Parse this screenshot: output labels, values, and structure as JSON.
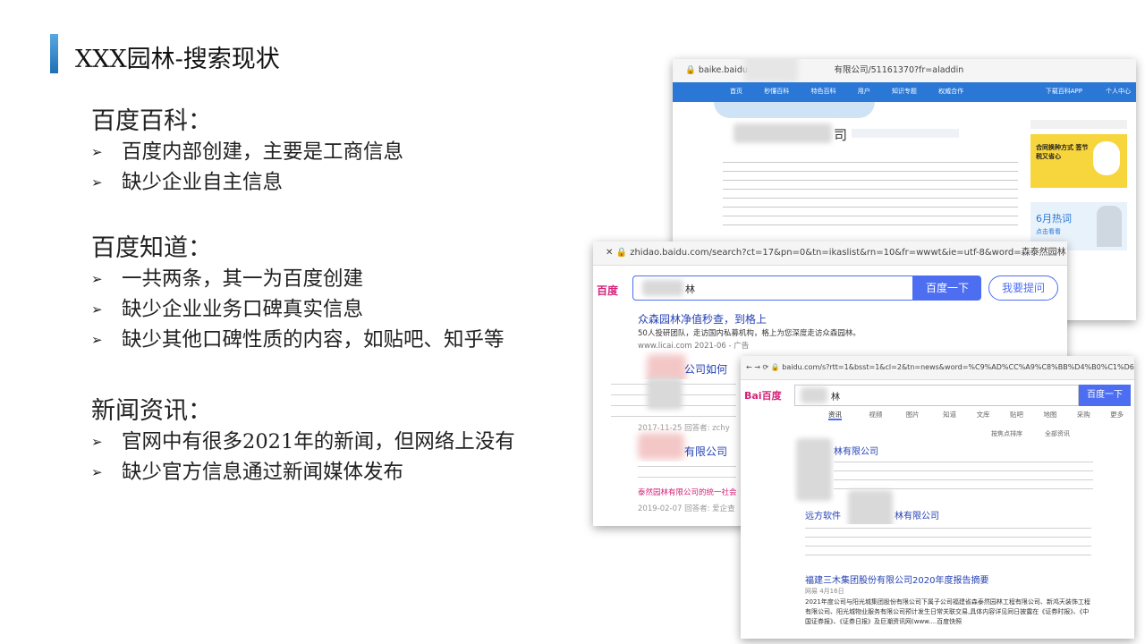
{
  "slide": {
    "title": "XXX园林-搜索现状",
    "accent": "#1f6fb5"
  },
  "sections": [
    {
      "heading": "百度百科：",
      "bullets": [
        "百度内部创建，主要是工商信息",
        "缺少企业自主信息"
      ]
    },
    {
      "heading": "百度知道：",
      "bullets": [
        "一共两条，其一为百度创建",
        "缺少企业业务口碑真实信息",
        "缺少其他口碑性质的内容，如贴吧、知乎等"
      ]
    },
    {
      "heading": "新闻资讯：",
      "bullets": [
        "官网中有很多2021年的新闻，但网络上没有",
        "缺少官方信息通过新闻媒体发布"
      ]
    }
  ],
  "baike": {
    "url_prefix": "baike.baidu.com/",
    "url_suffix": "有限公司/51161370?fr=aladdin",
    "nav": [
      "首页",
      "秒懂百科",
      "特色百科",
      "用户",
      "知识专题",
      "权威合作"
    ],
    "app_label": "下载百科APP",
    "center_label": "个人中心",
    "title_char": "司",
    "ad_title": "合同换种方式 签节税又省心",
    "hot_label": "6月热词",
    "hot_sub": "点击看看"
  },
  "zhidao": {
    "url": "zhidao.baidu.com/search?ct=17&pn=0&tn=ikaslist&rn=10&fr=wwwt&ie=utf-8&word=森泰然园林",
    "logo": "百度",
    "query": "林",
    "search_btn": "百度一下",
    "ask_btn": "我要提问",
    "result1_title": "众森园林净值秒查，到格上",
    "result1_desc": "50人投研团队，走访国内私募机构，格上为您深度走访众森园林。",
    "result1_meta": "www.licai.com  2021-06 - 广告",
    "result2_title": "公司如何",
    "result2_meta": "2017-11-25  回答者: zchy",
    "result3_title": "有限公司",
    "result3_meta": "2019-02-07  回答者: 爱企查",
    "result3_desc": "泰然园林有限公司的统一社会"
  },
  "news": {
    "url": "baidu.com/s?rtt=1&bsst=1&cl=2&tn=news&word=%C9%AD%CC%A9%C8%BB%D4%B0%C1%D6&f",
    "logo": "Bai百度",
    "query": "林",
    "search_btn": "百度一下",
    "tabs": [
      "资讯",
      "视频",
      "图片",
      "知道",
      "文库",
      "贴吧",
      "地图",
      "采购",
      "更多"
    ],
    "sort_label": "按焦点排序",
    "all_label": "全部资讯",
    "item1_title": "林有限公司",
    "item2_title": "远方软件",
    "item2_title_tail": "林有限公司",
    "item3_title": "福建三木集团股份有限公司2020年度报告摘要",
    "item3_meta": "网易  4月16日",
    "item3_desc": "2021年度公司与阳光城集团股份有限公司下属子公司福建省森泰然园林工程有限公司、新鸿天装饰工程有限公司、阳光城物业服务有限公司预计发生日常关联交易,具体内容详见同日披露在《证券时报》、《中国证券报》、《证券日报》及巨潮资讯网(www....百度快照"
  }
}
